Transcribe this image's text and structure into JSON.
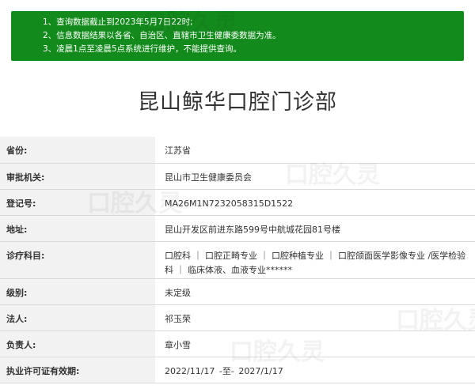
{
  "notice": {
    "lines": [
      "1、查询数据截止到2023年5月7日22时;",
      "2、信息数据结果以各省、自治区、直辖市卫生健康委数据为准。",
      "3、凌晨1点至凌晨5点系统进行维护，不能提供查询。"
    ]
  },
  "clinic": {
    "name": "昆山鲸华口腔门诊部",
    "rows": [
      {
        "label": "省份:",
        "value": "江苏省"
      },
      {
        "label": "审批机关:",
        "value": "昆山市卫生健康委员会"
      },
      {
        "label": "登记号:",
        "value": "MA26M1N7232058315D1522"
      },
      {
        "label": "地址:",
        "value": "昆山开发区前进东路599号中航城花园81号楼"
      },
      {
        "label": "诊疗科目:",
        "value": "口腔科 ｜ 口腔正畸专业 ｜ 口腔种植专业 ｜ 口腔颌面医学影像专业 /医学检验科 ｜ 临床体液、血液专业******"
      },
      {
        "label": "级别:",
        "value": "未定级"
      },
      {
        "label": "法人:",
        "value": "祁玉荣"
      },
      {
        "label": "负责人:",
        "value": "章小雪"
      },
      {
        "label": "执业许可证有效期:",
        "value": "2022/11/17 -至- 2027/1/17"
      }
    ]
  },
  "watermark": {
    "text": "口腔久灵",
    "sub": "kq90.com"
  }
}
